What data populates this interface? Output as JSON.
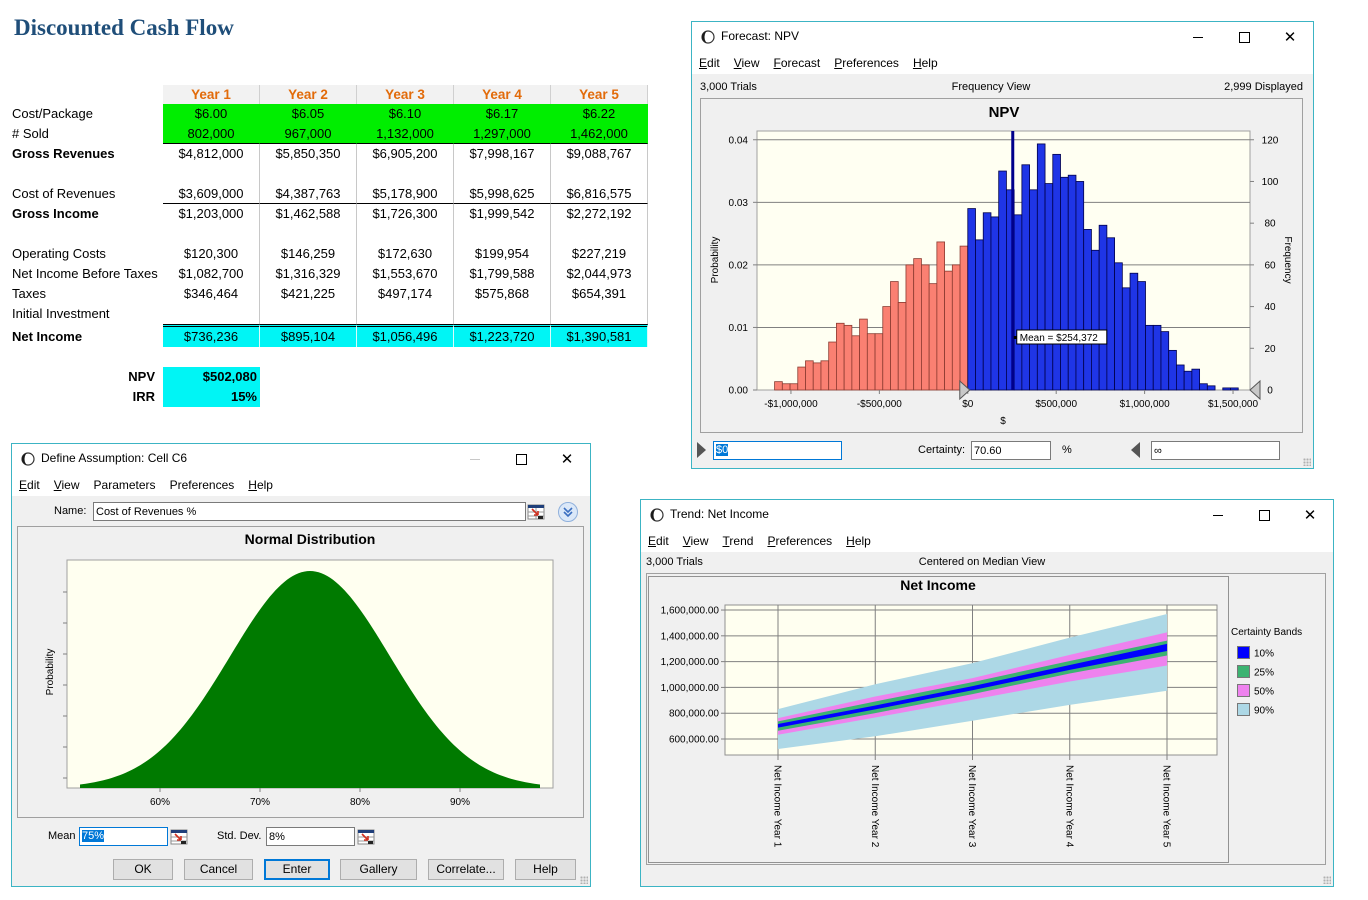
{
  "spreadsheet": {
    "title": "Discounted Cash Flow",
    "columns": [
      "Year 1",
      "Year 2",
      "Year 3",
      "Year 4",
      "Year 5"
    ],
    "rows": [
      {
        "label": "Cost/Package",
        "values": [
          "$6.00",
          "$6.05",
          "$6.10",
          "$6.17",
          "$6.22"
        ],
        "cell_type": "assumption"
      },
      {
        "label": "# Sold",
        "values": [
          "802,000",
          "967,000",
          "1,132,000",
          "1,297,000",
          "1,462,000"
        ],
        "cell_type": "assumption"
      },
      {
        "label": "Gross Revenues",
        "values": [
          "$4,812,000",
          "$5,850,350",
          "$6,905,200",
          "$7,998,167",
          "$9,088,767"
        ]
      },
      {
        "label": "",
        "values": [
          "",
          "",
          "",
          "",
          ""
        ]
      },
      {
        "label": "Cost of Revenues",
        "values": [
          "$3,609,000",
          "$4,387,763",
          "$5,178,900",
          "$5,998,625",
          "$6,816,575"
        ]
      },
      {
        "label": "Gross Income",
        "values": [
          "$1,203,000",
          "$1,462,588",
          "$1,726,300",
          "$1,999,542",
          "$2,272,192"
        ]
      },
      {
        "label": "",
        "values": [
          "",
          "",
          "",
          "",
          ""
        ]
      },
      {
        "label": "Operating Costs",
        "values": [
          "$120,300",
          "$146,259",
          "$172,630",
          "$199,954",
          "$227,219"
        ]
      },
      {
        "label": "Net Income Before Taxes",
        "values": [
          "$1,082,700",
          "$1,316,329",
          "$1,553,670",
          "$1,799,588",
          "$2,044,973"
        ]
      },
      {
        "label": "Taxes",
        "values": [
          "$346,464",
          "$421,225",
          "$497,174",
          "$575,868",
          "$654,391"
        ]
      },
      {
        "label": "Initial Investment",
        "values": [
          "",
          "",
          "",
          "",
          ""
        ]
      },
      {
        "label": "Net Income",
        "values": [
          "$736,236",
          "$895,104",
          "$1,056,496",
          "$1,223,720",
          "$1,390,581"
        ],
        "cell_type": "forecast"
      }
    ],
    "summary": [
      {
        "label": "NPV",
        "value": "$502,080"
      },
      {
        "label": "IRR",
        "value": "15%"
      }
    ]
  },
  "colors": {
    "title": "#1f4e79",
    "year_header": "#e26b0a",
    "assumption_cell": "#00ee00",
    "forecast_cell": "#00f5f5",
    "window_border": "#3cb4c4"
  },
  "forecast_window": {
    "title": "Forecast: NPV",
    "menu": [
      "Edit",
      "View",
      "Forecast",
      "Preferences",
      "Help"
    ],
    "trials": "3,000 Trials",
    "view": "Frequency View",
    "displayed": "2,999 Displayed",
    "lower_bound": "$0",
    "certainty_label": "Certainty:",
    "certainty_value": "70.60",
    "certainty_unit": "%",
    "upper_bound": "∞"
  },
  "assumption_window": {
    "title": "Define Assumption: Cell C6",
    "menu": [
      "Edit",
      "View",
      "Parameters",
      "Preferences",
      "Help"
    ],
    "name_label": "Name:",
    "name_value": "Cost of Revenues %",
    "mean_label": "Mean",
    "mean_value": "75%",
    "std_dev_label": "Std. Dev.",
    "std_dev_value": "8%",
    "buttons": [
      "OK",
      "Cancel",
      "Enter",
      "Gallery",
      "Correlate...",
      "Help"
    ]
  },
  "trend_window": {
    "title": "Trend: Net Income",
    "menu": [
      "Edit",
      "View",
      "Trend",
      "Preferences",
      "Help"
    ],
    "trials": "3,000 Trials",
    "view": "Centered on Median View"
  },
  "chart_data": [
    {
      "type": "bar",
      "title": "NPV",
      "xlabel": "$",
      "ylabel": "Probability",
      "y2label": "Frequency",
      "trials": 3000,
      "bin_start": -1092500,
      "bin_width": 43700,
      "frequencies": [
        4,
        3,
        3,
        11,
        14,
        13,
        14,
        23,
        32,
        31,
        26,
        34,
        27,
        27,
        40,
        52,
        42,
        60,
        63,
        60,
        51,
        71,
        57,
        60,
        69,
        87,
        72,
        85,
        83,
        105,
        96,
        84,
        108,
        96,
        118,
        99,
        113,
        102,
        103,
        100,
        77,
        67,
        79,
        73,
        61,
        49,
        56,
        52,
        31,
        31,
        28,
        19,
        12,
        9,
        10,
        3,
        2,
        0,
        1,
        1
      ],
      "xlim": [
        -1192000,
        1596000
      ],
      "ylim": [
        0,
        0.0414
      ],
      "xticks": [
        -1000000,
        -500000,
        0,
        500000,
        1000000,
        1500000
      ],
      "xtick_labels": [
        "-$1,000,000",
        "-$500,000",
        "$0",
        "$500,000",
        "$1,000,000",
        "$1,500,000"
      ],
      "yticks": [
        0,
        0.01,
        0.02,
        0.03,
        0.04
      ],
      "ytick_labels": [
        "0.00",
        "0.01",
        "0.02",
        "0.03",
        "0.04"
      ],
      "y2ticks": [
        0,
        20,
        40,
        60,
        80,
        100,
        120
      ],
      "y2tick_labels": [
        "0",
        "20",
        "40",
        "60",
        "80",
        "100",
        "120"
      ],
      "mean": 254372,
      "mean_label": "Mean = $254,372",
      "certainty_range": [
        0,
        null
      ],
      "grid": "horizontal",
      "colors": {
        "outside": "#fa8072",
        "inside": "#1f35e6",
        "mean_line": "#00008b"
      }
    },
    {
      "type": "area",
      "title": "Normal Distribution",
      "ylabel": "Probability",
      "distribution": "Normal",
      "mean": 0.75,
      "std_dev": 0.08,
      "x_range": [
        0.52,
        0.98
      ],
      "xlim": [
        0.507,
        0.993
      ],
      "ylim": [
        0,
        5.24
      ],
      "xticks": [
        0.6,
        0.7,
        0.8,
        0.9
      ],
      "xtick_labels": [
        "60%",
        "70%",
        "80%",
        "90%"
      ],
      "color": "#007a00"
    },
    {
      "type": "area",
      "title": "Net Income",
      "categories": [
        "Net Income Year 1",
        "Net Income Year 2",
        "Net Income Year 3",
        "Net Income Year 4",
        "Net Income Year 5"
      ],
      "ylim": [
        476000,
        1639000
      ],
      "yticks": [
        600000,
        800000,
        1000000,
        1200000,
        1400000,
        1600000
      ],
      "ytick_labels": [
        "600,000.00",
        "800,000.00",
        "1,000,000.00",
        "1,200,000.00",
        "1,400,000.00",
        "1,600,000.00"
      ],
      "legend_title": "Certainty Bands",
      "legend": "right",
      "grid": "both",
      "bands": [
        {
          "name": "90%",
          "color": "#add8e6",
          "upper": [
            832000,
            1025000,
            1188000,
            1386000,
            1569000
          ],
          "lower": [
            523000,
            621000,
            742000,
            865000,
            974000
          ]
        },
        {
          "name": "50%",
          "color": "#ee82ee",
          "upper": [
            762000,
            930000,
            1072000,
            1252000,
            1427000
          ],
          "lower": [
            633000,
            767000,
            904000,
            1046000,
            1170000
          ]
        },
        {
          "name": "25%",
          "color": "#3cb371",
          "upper": [
            737000,
            891000,
            1041000,
            1205000,
            1363000
          ],
          "lower": [
            664000,
            801000,
            948000,
            1108000,
            1247000
          ]
        },
        {
          "name": "10%",
          "color": "#0000ff",
          "upper": [
            716000,
            860000,
            1010000,
            1174000,
            1338000
          ],
          "lower": [
            688000,
            830000,
            978000,
            1136000,
            1282000
          ]
        }
      ]
    }
  ]
}
